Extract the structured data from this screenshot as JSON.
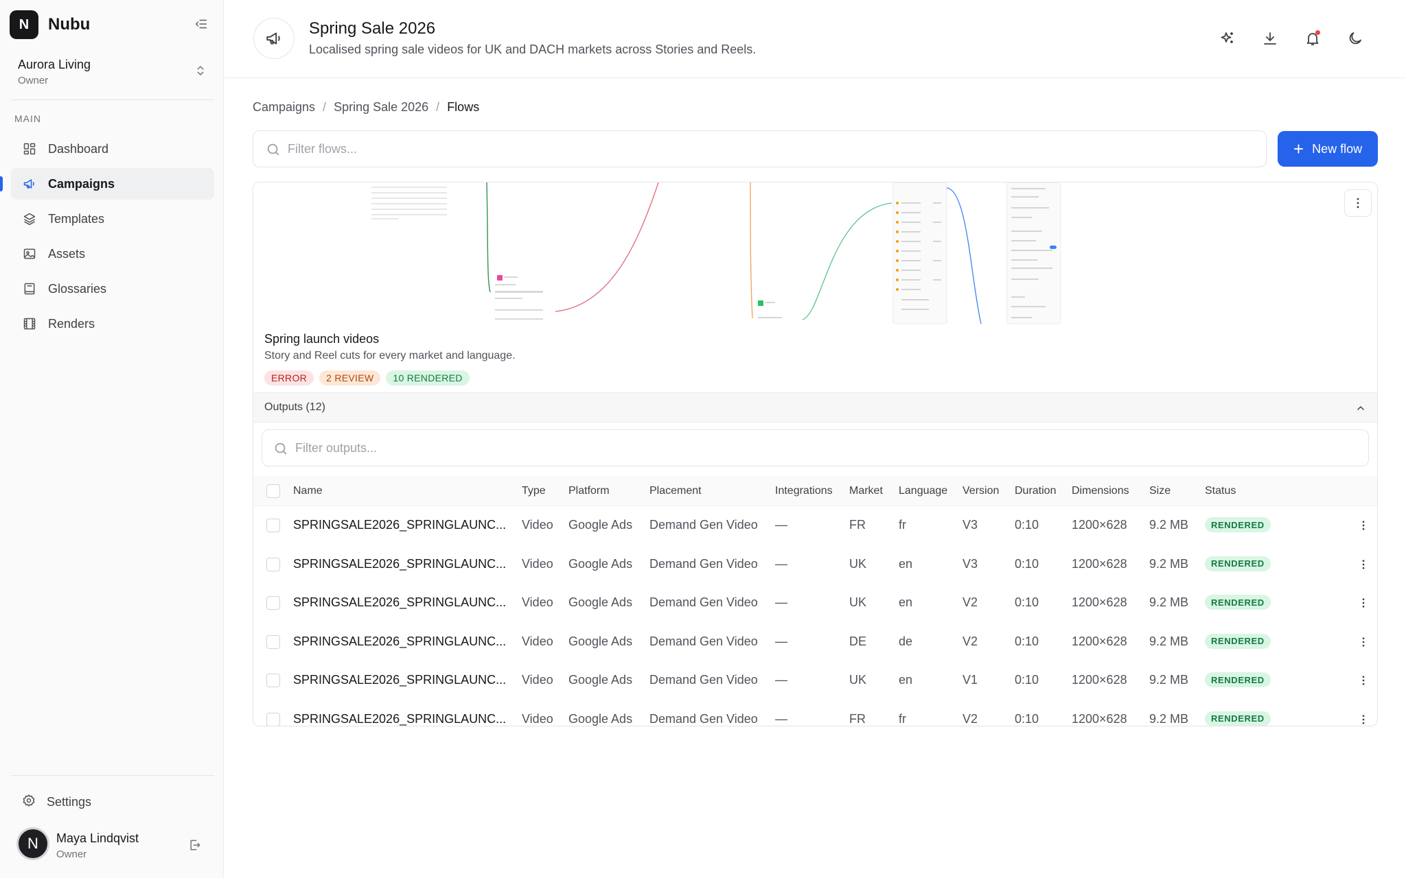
{
  "brand": {
    "logo_letter": "N",
    "name": "Nubu"
  },
  "workspace": {
    "name": "Aurora Living",
    "role": "Owner"
  },
  "sidebar": {
    "section_label": "MAIN",
    "items": [
      {
        "label": "Dashboard",
        "icon": "dashboard-icon"
      },
      {
        "label": "Campaigns",
        "icon": "megaphone-icon",
        "active": true
      },
      {
        "label": "Templates",
        "icon": "layers-icon"
      },
      {
        "label": "Assets",
        "icon": "image-icon"
      },
      {
        "label": "Glossaries",
        "icon": "book-icon"
      },
      {
        "label": "Renders",
        "icon": "film-icon"
      }
    ],
    "settings_label": "Settings"
  },
  "user": {
    "initial": "N",
    "name": "Maya Lindqvist",
    "role": "Owner"
  },
  "header": {
    "title": "Spring Sale 2026",
    "subtitle": "Localised spring sale videos for UK and DACH markets across Stories and Reels.",
    "actions": [
      "sparkle-icon",
      "download-icon",
      "bell-icon",
      "moon-icon"
    ]
  },
  "breadcrumb": [
    "Campaigns",
    "Spring Sale 2026",
    "Flows"
  ],
  "search": {
    "placeholder": "Filter flows..."
  },
  "new_flow_label": "New flow",
  "flow": {
    "title": "Spring launch videos",
    "description": "Story and Reel cuts for every market and language.",
    "badges": {
      "error": "ERROR",
      "review": "2 REVIEW",
      "rendered": "10 RENDERED"
    },
    "outputs_label": "Outputs (12)",
    "outputs_placeholder": "Filter outputs..."
  },
  "table": {
    "columns": [
      "Name",
      "Type",
      "Platform",
      "Placement",
      "Integrations",
      "Market",
      "Language",
      "Version",
      "Duration",
      "Dimensions",
      "Size",
      "Status"
    ],
    "rows": [
      {
        "name": "SPRINGSALE2026_SPRINGLAUNC...",
        "type": "Video",
        "platform": "Google Ads",
        "placement": "Demand Gen Video",
        "integrations": "—",
        "market": "FR",
        "language": "fr",
        "version": "V3",
        "duration": "0:10",
        "dimensions": "1200×628",
        "size": "9.2 MB",
        "status": "RENDERED"
      },
      {
        "name": "SPRINGSALE2026_SPRINGLAUNC...",
        "type": "Video",
        "platform": "Google Ads",
        "placement": "Demand Gen Video",
        "integrations": "—",
        "market": "UK",
        "language": "en",
        "version": "V3",
        "duration": "0:10",
        "dimensions": "1200×628",
        "size": "9.2 MB",
        "status": "RENDERED"
      },
      {
        "name": "SPRINGSALE2026_SPRINGLAUNC...",
        "type": "Video",
        "platform": "Google Ads",
        "placement": "Demand Gen Video",
        "integrations": "—",
        "market": "UK",
        "language": "en",
        "version": "V2",
        "duration": "0:10",
        "dimensions": "1200×628",
        "size": "9.2 MB",
        "status": "RENDERED"
      },
      {
        "name": "SPRINGSALE2026_SPRINGLAUNC...",
        "type": "Video",
        "platform": "Google Ads",
        "placement": "Demand Gen Video",
        "integrations": "—",
        "market": "DE",
        "language": "de",
        "version": "V2",
        "duration": "0:10",
        "dimensions": "1200×628",
        "size": "9.2 MB",
        "status": "RENDERED"
      },
      {
        "name": "SPRINGSALE2026_SPRINGLAUNC...",
        "type": "Video",
        "platform": "Google Ads",
        "placement": "Demand Gen Video",
        "integrations": "—",
        "market": "UK",
        "language": "en",
        "version": "V1",
        "duration": "0:10",
        "dimensions": "1200×628",
        "size": "9.2 MB",
        "status": "RENDERED"
      },
      {
        "name": "SPRINGSALE2026_SPRINGLAUNC...",
        "type": "Video",
        "platform": "Google Ads",
        "placement": "Demand Gen Video",
        "integrations": "—",
        "market": "FR",
        "language": "fr",
        "version": "V2",
        "duration": "0:10",
        "dimensions": "1200×628",
        "size": "9.2 MB",
        "status": "RENDERED"
      }
    ]
  },
  "colors": {
    "accent": "#2563eb",
    "rendered_bg": "#d9f5e3",
    "rendered_text": "#147a43",
    "error_bg": "#fde2e4",
    "review_bg": "#fde7d6"
  }
}
